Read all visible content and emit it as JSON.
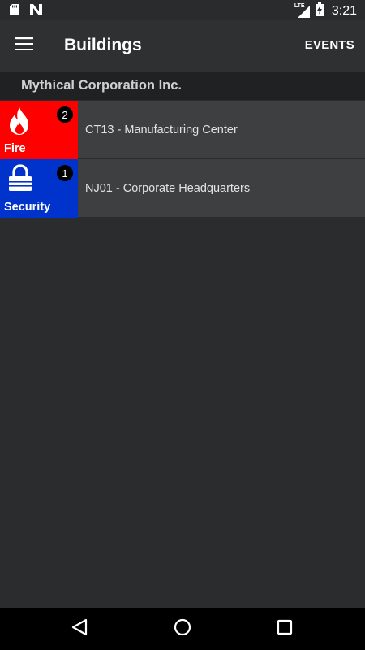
{
  "status_bar": {
    "time": "3:21",
    "network": "LTE",
    "icons": [
      "sd-card-icon",
      "notification-n-icon",
      "signal-icon",
      "battery-charging-icon"
    ]
  },
  "app_bar": {
    "title": "Buildings",
    "menu_icon": "hamburger-menu-icon",
    "action_label": "EVENTS"
  },
  "organization": {
    "name": "Mythical Corporation Inc."
  },
  "buildings": [
    {
      "name": "CT13 - Manufacturing Center",
      "alarm_type": "Fire",
      "alarm_count": "2",
      "alarm_color": "#ff0000",
      "icon": "fire-icon"
    },
    {
      "name": "NJ01 - Corporate Headquarters",
      "alarm_type": "Security",
      "alarm_count": "1",
      "alarm_color": "#0033cc",
      "icon": "lock-icon"
    }
  ],
  "nav_bar": {
    "icons": [
      "back-icon",
      "home-icon",
      "recents-icon"
    ]
  }
}
